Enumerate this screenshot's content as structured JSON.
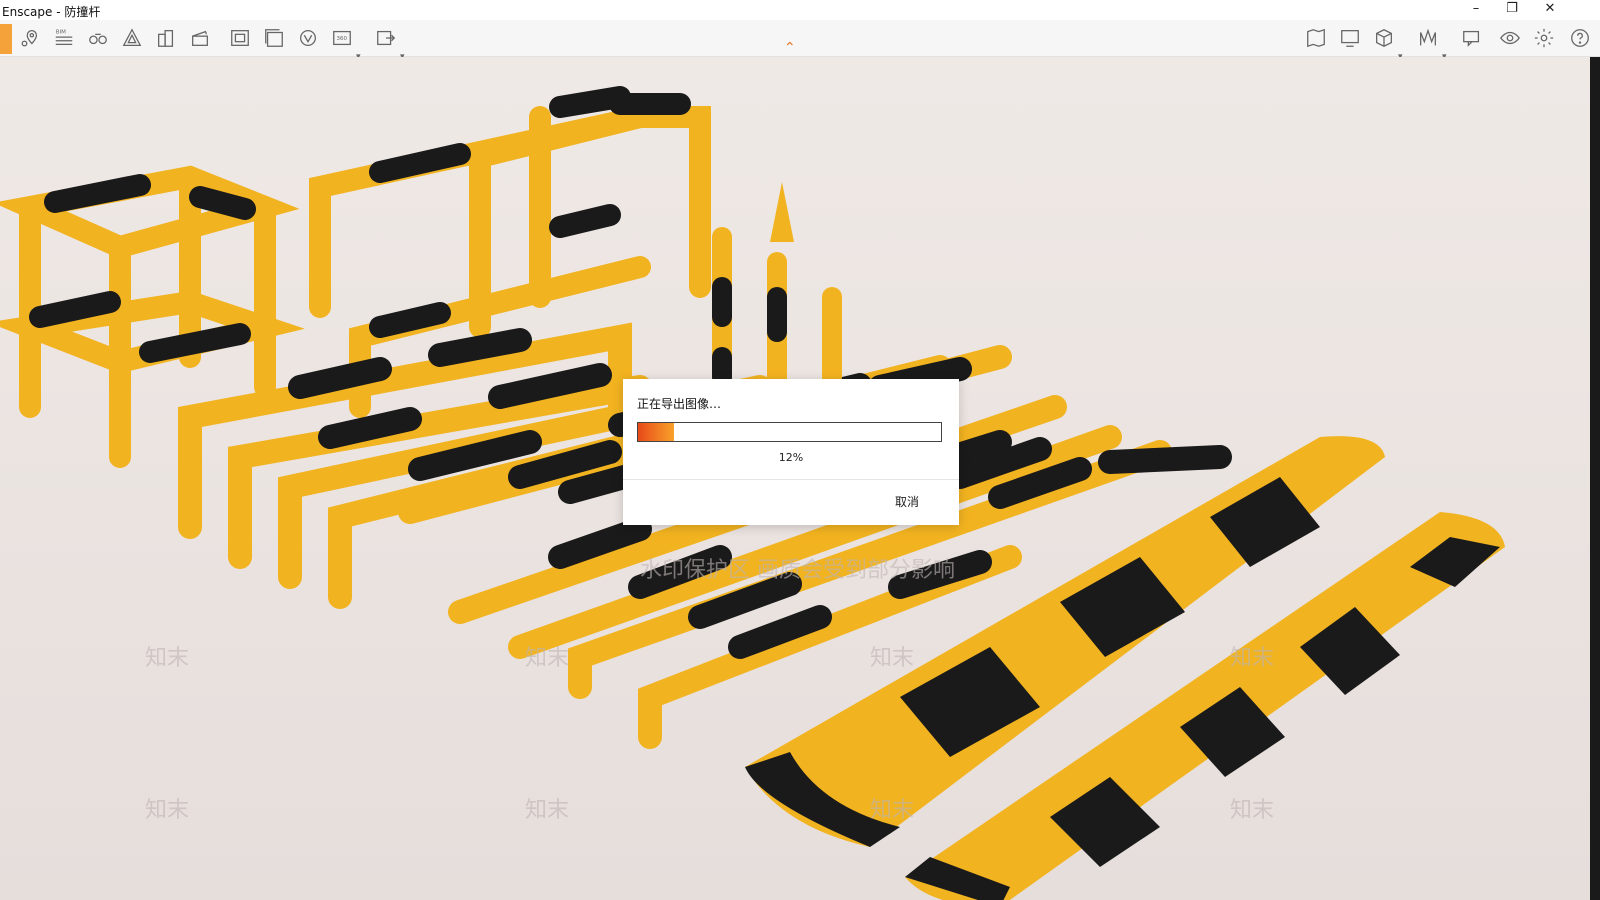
{
  "window": {
    "title": "Enscape - 防撞杆",
    "minimize_glyph": "–",
    "restore_glyph": "❐",
    "close_glyph": "✕"
  },
  "toolbar": {
    "left_icons": [
      "home-icon",
      "location-pin-icon",
      "bim-icon",
      "binoculars-icon",
      "asset-library-icon",
      "buildings-icon",
      "clapperboard-icon",
      "render-image-icon",
      "batch-render-icon",
      "panorama-icon",
      "360-icon",
      "export-icon"
    ],
    "right_icons": [
      "map-icon",
      "screen-icon",
      "cube-icon",
      "vr-icon",
      "chat-icon",
      "eye-icon",
      "gear-icon",
      "help-icon"
    ],
    "collapse_glyph": "⌃"
  },
  "dialog": {
    "title": "正在导出图像…",
    "progress_fraction": 0.12,
    "progress_text": "12%",
    "cancel_label": "取消"
  },
  "watermark": {
    "line1": "水印保护区 画质会受到部分影响",
    "brand": "知末"
  },
  "colors": {
    "safety_yellow": "#f2b320",
    "stripe_black": "#1a1a1a",
    "floor": "#ece6e3",
    "progress_start": "#e84a1a",
    "progress_end": "#f8a12a"
  }
}
